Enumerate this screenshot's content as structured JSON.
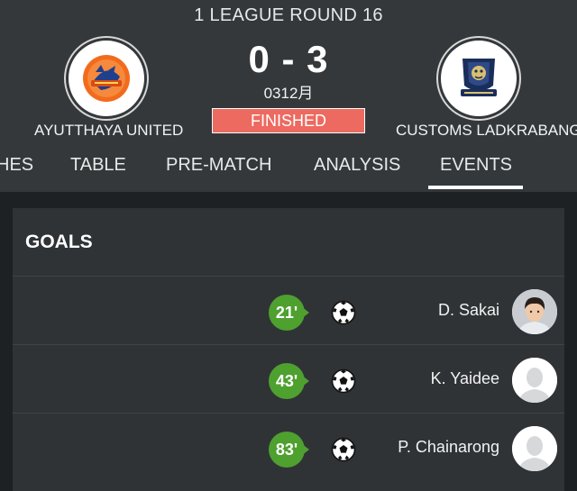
{
  "header": {
    "round": "1 LEAGUE ROUND 16",
    "score": "0 - 3",
    "date": "0312月",
    "status": "FINISHED",
    "home_team": "AYUTTHAYA UNITED",
    "away_team": "CUSTOMS LADKRABANG"
  },
  "tabs": [
    {
      "label": "HES"
    },
    {
      "label": "TABLE"
    },
    {
      "label": "PRE-MATCH"
    },
    {
      "label": "ANALYSIS"
    },
    {
      "label": "EVENTS",
      "active": true
    }
  ],
  "goals": {
    "title": "GOALS",
    "events": [
      {
        "minute": "21'",
        "player": "D. Sakai",
        "icon": "soccer-ball-icon",
        "avatar": "player-photo"
      },
      {
        "minute": "43'",
        "player": "K. Yaidee",
        "icon": "soccer-ball-icon",
        "avatar": "player-placeholder"
      },
      {
        "minute": "83'",
        "player": "P. Chainarong",
        "icon": "soccer-ball-icon",
        "avatar": "player-placeholder"
      }
    ]
  },
  "colors": {
    "header_bg": "#34383b",
    "panel_bg": "#2f3336",
    "status_bg": "#ec6a60",
    "minute_bg": "#4ea02f"
  }
}
